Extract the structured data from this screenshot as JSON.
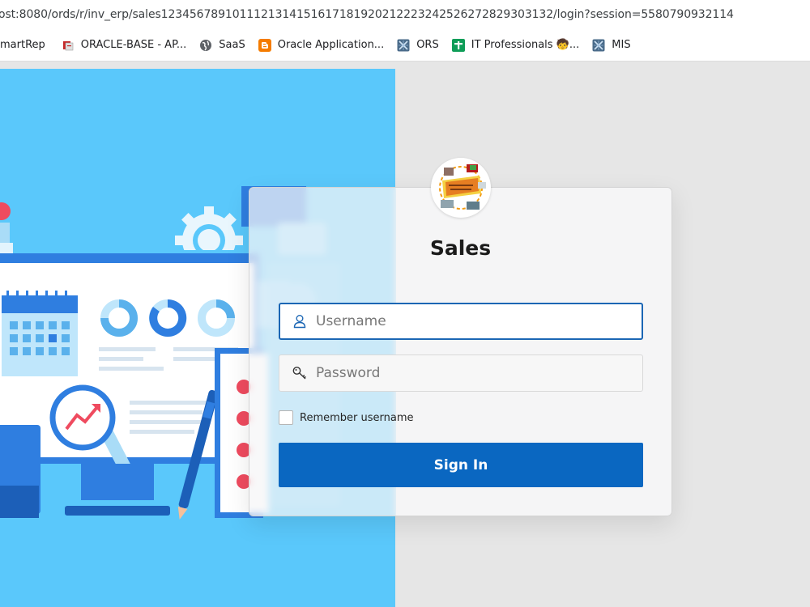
{
  "browser": {
    "url": "ost:8080/ords/r/inv_erp/sales1234567891011121314151617181920212223242526272829303132/login?session=5580790932114"
  },
  "bookmarks": [
    {
      "label": "martRep",
      "icon": "page-icon"
    },
    {
      "label": "ORACLE-BASE - AP...",
      "icon": "oracle-base-icon"
    },
    {
      "label": "SaaS",
      "icon": "globe-icon"
    },
    {
      "label": "Oracle Application...",
      "icon": "blogger-icon"
    },
    {
      "label": "ORS",
      "icon": "app-grid-icon"
    },
    {
      "label": "IT Professionals 🧒...",
      "icon": "plus-icon"
    },
    {
      "label": "MIS",
      "icon": "app-grid-icon"
    }
  ],
  "login": {
    "title": "Sales",
    "username_placeholder": "Username",
    "password_placeholder": "Password",
    "remember_label": "Remember username",
    "signin_label": "Sign In"
  },
  "colors": {
    "hero_bg": "#5ac8fb",
    "accent": "#0a67c1",
    "focus_border": "#1b66b4"
  }
}
